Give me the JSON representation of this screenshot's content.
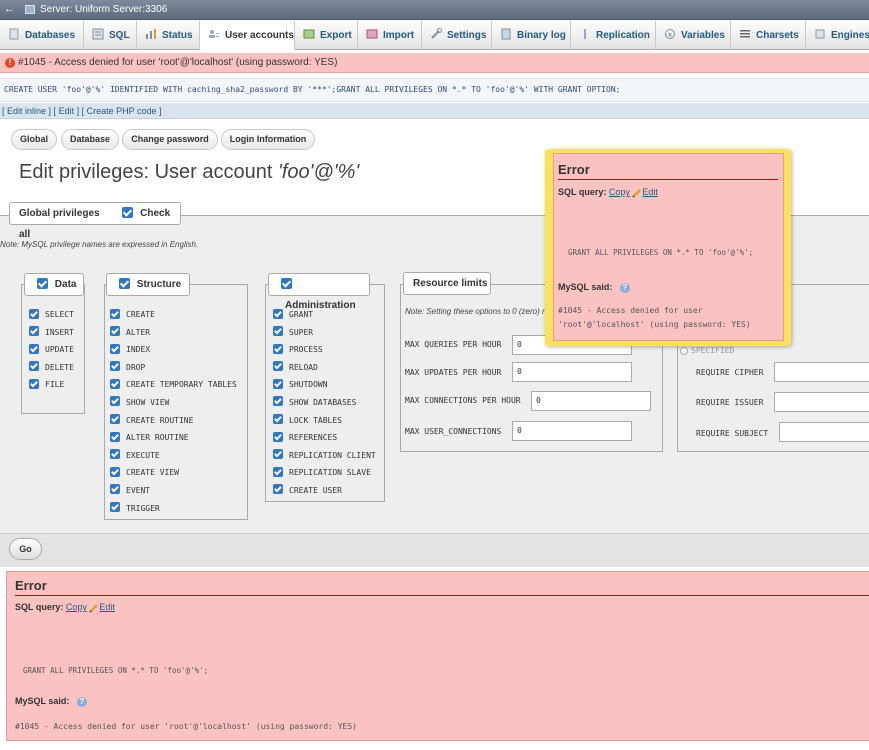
{
  "server_bar": {
    "title": "Server: Uniform Server:3306"
  },
  "tabs": [
    {
      "label": "Databases",
      "icon": "database-icon"
    },
    {
      "label": "SQL",
      "icon": "sql-icon"
    },
    {
      "label": "Status",
      "icon": "status-icon"
    },
    {
      "label": "User accounts",
      "icon": "users-icon"
    },
    {
      "label": "Export",
      "icon": "export-icon"
    },
    {
      "label": "Import",
      "icon": "import-icon"
    },
    {
      "label": "Settings",
      "icon": "wrench-icon"
    },
    {
      "label": "Binary log",
      "icon": "log-icon"
    },
    {
      "label": "Replication",
      "icon": "replication-icon"
    },
    {
      "label": "Variables",
      "icon": "variables-icon"
    },
    {
      "label": "Charsets",
      "icon": "charsets-icon"
    },
    {
      "label": "Engines",
      "icon": "engines-icon"
    }
  ],
  "error_banner": {
    "text": "#1045 - Access denied for user 'root'@'localhost' (using password: YES)"
  },
  "query": {
    "text": "CREATE USER 'foo'@'%' IDENTIFIED WITH caching_sha2_password BY '***';GRANT ALL PRIVILEGES ON *.* TO 'foo'@'%' WITH GRANT OPTION;"
  },
  "query_links": {
    "edit_inline": "Edit inline",
    "edit": "Edit",
    "create_php": "Create PHP code"
  },
  "subtabs": [
    "Global",
    "Database",
    "Change password",
    "Login Information"
  ],
  "page_title": {
    "prefix": "Edit privileges: User account ",
    "account": "'foo'@'%'"
  },
  "global_privileges": {
    "label": "Global privileges",
    "check_all": "Check all"
  },
  "note": "Note: MySQL privilege names are expressed in English.",
  "groups": {
    "data": {
      "label": "Data",
      "items": [
        "SELECT",
        "INSERT",
        "UPDATE",
        "DELETE",
        "FILE"
      ]
    },
    "structure": {
      "label": "Structure",
      "items": [
        "CREATE",
        "ALTER",
        "INDEX",
        "DROP",
        "CREATE TEMPORARY TABLES",
        "SHOW VIEW",
        "CREATE ROUTINE",
        "ALTER ROUTINE",
        "EXECUTE",
        "CREATE VIEW",
        "EVENT",
        "TRIGGER"
      ]
    },
    "administration": {
      "label": "Administration",
      "items": [
        "GRANT",
        "SUPER",
        "PROCESS",
        "RELOAD",
        "SHUTDOWN",
        "SHOW DATABASES",
        "LOCK TABLES",
        "REFERENCES",
        "REPLICATION CLIENT",
        "REPLICATION SLAVE",
        "CREATE USER"
      ]
    }
  },
  "resource_limits": {
    "label": "Resource limits",
    "note": "Note: Setting these options to 0 (zero) r",
    "rows": [
      {
        "label": "MAX QUERIES PER HOUR",
        "value": "0"
      },
      {
        "label": "MAX UPDATES PER HOUR",
        "value": "0"
      },
      {
        "label": "MAX CONNECTIONS PER HOUR",
        "value": "0"
      },
      {
        "label": "MAX USER_CONNECTIONS",
        "value": "0"
      }
    ]
  },
  "ssl": {
    "specified": "SPECIFIED",
    "rows": [
      "REQUIRE CIPHER",
      "REQUIRE ISSUER",
      "REQUIRE SUBJECT"
    ]
  },
  "go_button": "Go",
  "error_popup": {
    "title": "Error",
    "sql_query_label": "SQL query:",
    "copy": "Copy",
    "edit": "Edit",
    "code": "GRANT ALL PRIVILEGES ON  *.* TO 'foo'@'%';",
    "mysql_said": "MySQL said:",
    "message_line1": "#1045 - Access denied for user",
    "message_line2": "'root'@'localhost' (using password: YES)"
  },
  "error_bottom": {
    "title": "Error",
    "sql_query_label": "SQL query:",
    "copy": "Copy",
    "edit": "Edit",
    "code": "GRANT ALL PRIVILEGES ON  *.* TO 'foo'@'%';",
    "mysql_said": "MySQL said:",
    "message": "#1045 - Access denied for user 'root'@'localhost' (using password: YES)"
  }
}
